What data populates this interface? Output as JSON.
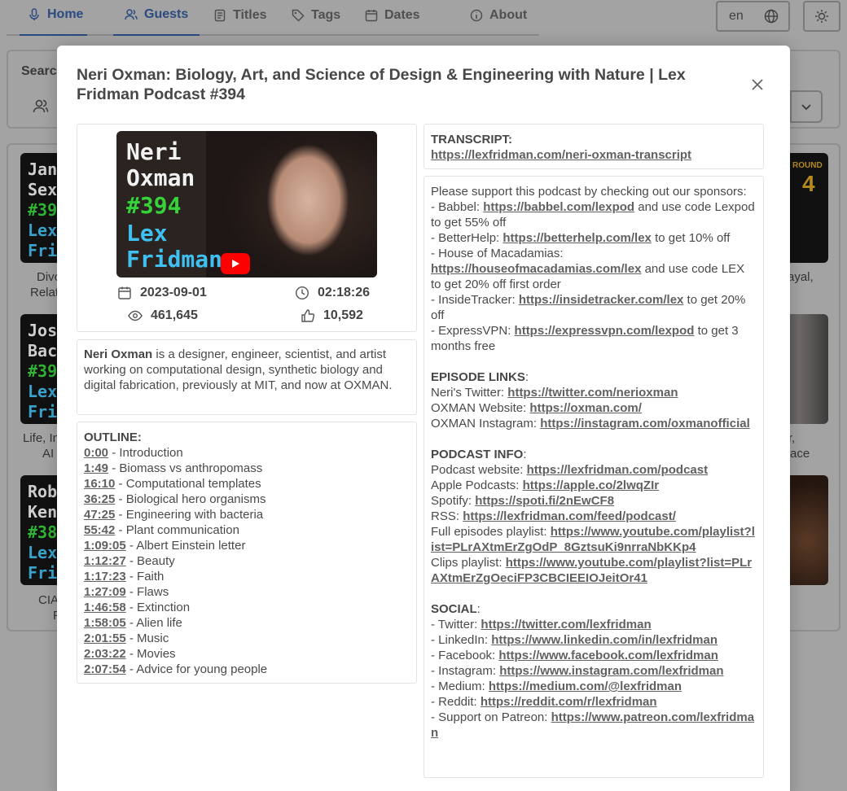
{
  "nav": {
    "items": [
      {
        "label": "Home"
      },
      {
        "label": "Guests"
      },
      {
        "label": "Titles"
      },
      {
        "label": "Tags"
      },
      {
        "label": "Dates"
      },
      {
        "label": "About"
      }
    ],
    "language": "en"
  },
  "search": {
    "label": "Search"
  },
  "background_cards": [
    {
      "lines": [
        "Jan",
        "Sex",
        "#39",
        "Lex",
        "Frid"
      ],
      "caption": [
        "Divo",
        "Relat"
      ]
    },
    {
      "lines": [
        "Jos",
        "Bac",
        "#39",
        "Lex",
        "Frid"
      ],
      "caption": [
        "Life, In",
        "AI"
      ]
    },
    {
      "lines": [
        "Rob",
        "Ken",
        "#38",
        "Lex",
        "Frid"
      ],
      "caption": [
        "CIA",
        "F"
      ]
    }
  ],
  "background_cards_right": [
    {
      "badge": "ROUND",
      "number": "4",
      "caption": [
        "rayal,",
        ""
      ]
    },
    {
      "caption": [
        "r,",
        "ace"
      ]
    },
    {
      "caption": [
        "",
        ""
      ]
    }
  ],
  "modal": {
    "title": "Neri Oxman: Biology, Art, and Science of Design & Engineering with Nature | Lex Fridman Podcast #394",
    "thumbnail": {
      "lines": [
        "Neri",
        "Oxman",
        "#394",
        "Lex",
        "Fridman"
      ]
    },
    "date": "2023-09-01",
    "duration": "02:18:26",
    "views": "461,645",
    "likes": "10,592",
    "bio": {
      "name": "Neri Oxman",
      "rest": " is a designer, engineer, scientist, and artist working on computational design, synthetic biology and digital fabrication, previously at MIT, and now at OXMAN."
    },
    "outline_heading": "OUTLINE:",
    "outline": [
      {
        "time": "0:00",
        "topic": " - Introduction"
      },
      {
        "time": "1:49",
        "topic": " - Biomass vs anthropomass"
      },
      {
        "time": "16:10",
        "topic": " - Computational templates"
      },
      {
        "time": "36:25",
        "topic": " - Biological hero organisms"
      },
      {
        "time": "47:25",
        "topic": " - Engineering with bacteria"
      },
      {
        "time": "55:42",
        "topic": " - Plant communication"
      },
      {
        "time": "1:09:05",
        "topic": " - Albert Einstein letter"
      },
      {
        "time": "1:12:27",
        "topic": " - Beauty"
      },
      {
        "time": "1:17:23",
        "topic": " - Faith"
      },
      {
        "time": "1:27:09",
        "topic": " - Flaws"
      },
      {
        "time": "1:46:58",
        "topic": " - Extinction"
      },
      {
        "time": "1:58:05",
        "topic": " - Alien life"
      },
      {
        "time": "2:01:55",
        "topic": " - Music"
      },
      {
        "time": "2:03:22",
        "topic": " - Movies"
      },
      {
        "time": "2:07:54",
        "topic": " - Advice for young people"
      }
    ],
    "transcript": {
      "heading": "TRANSCRIPT:",
      "url": "https://lexfridman.com/neri-oxman-transcript"
    },
    "sponsors_intro": "Please support this podcast by checking out our sponsors:",
    "sponsors": [
      {
        "pre": "- Babbel: ",
        "url": "https://babbel.com/lexpod",
        "post": " and use code Lexpod to get 55% off"
      },
      {
        "pre": "- BetterHelp: ",
        "url": "https://betterhelp.com/lex",
        "post": " to get 10% off"
      },
      {
        "pre": "- House of Macadamias: ",
        "url": "https://houseofmacadamias.com/lex",
        "post": " and use code LEX to get 20% off first order"
      },
      {
        "pre": "- InsideTracker: ",
        "url": "https://insidetracker.com/lex",
        "post": " to get 20% off"
      },
      {
        "pre": "- ExpressVPN: ",
        "url": "https://expressvpn.com/lexpod",
        "post": " to get 3 months free"
      }
    ],
    "sections": [
      {
        "heading": "EPISODE LINKS",
        "rows": [
          {
            "pre": "Neri's Twitter: ",
            "url": "https://twitter.com/nerioxman"
          },
          {
            "pre": "OXMAN Website: ",
            "url": "https://oxman.com/"
          },
          {
            "pre": "OXMAN Instagram: ",
            "url": "https://instagram.com/oxmanofficial"
          }
        ]
      },
      {
        "heading": "PODCAST INFO",
        "rows": [
          {
            "pre": "Podcast website: ",
            "url": "https://lexfridman.com/podcast"
          },
          {
            "pre": "Apple Podcasts: ",
            "url": "https://apple.co/2lwqZIr"
          },
          {
            "pre": "Spotify: ",
            "url": "https://spoti.fi/2nEwCF8"
          },
          {
            "pre": "RSS: ",
            "url": "https://lexfridman.com/feed/podcast/"
          },
          {
            "pre": "Full episodes playlist: ",
            "url": "https://www.youtube.com/playlist?list=PLrAXtmErZgOdP_8GztsuKi9nrraNbKKp4"
          },
          {
            "pre": "Clips playlist: ",
            "url": "https://www.youtube.com/playlist?list=PLrAXtmErZgOeciFP3CBCIEEIOJeitOr41"
          }
        ]
      },
      {
        "heading": "SOCIAL",
        "rows": [
          {
            "pre": "- Twitter: ",
            "url": "https://twitter.com/lexfridman"
          },
          {
            "pre": "- LinkedIn: ",
            "url": "https://www.linkedin.com/in/lexfridman"
          },
          {
            "pre": "- Facebook: ",
            "url": "https://www.facebook.com/lexfridman"
          },
          {
            "pre": "- Instagram: ",
            "url": "https://www.instagram.com/lexfridman"
          },
          {
            "pre": "- Medium: ",
            "url": "https://medium.com/@lexfridman"
          },
          {
            "pre": "- Reddit: ",
            "url": "https://reddit.com/r/lexfridman"
          },
          {
            "pre": "- Support on Patreon: ",
            "url": "https://www.patreon.com/lexfridman"
          }
        ]
      }
    ]
  },
  "colors": {
    "accent": "#2b4a80",
    "overlay": "#a3a3a3",
    "thumb_green": "#35d33a",
    "thumb_blue": "#3fc0f0",
    "youtube_red": "#ff0000"
  }
}
